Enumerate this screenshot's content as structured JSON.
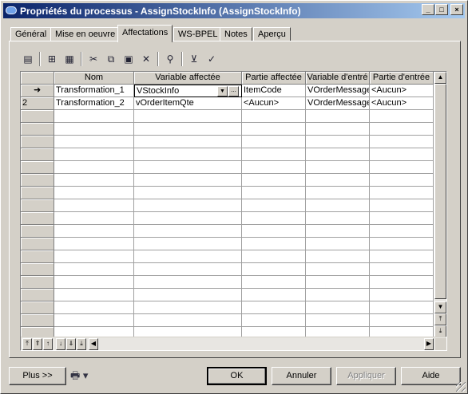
{
  "window": {
    "title": "Propriétés du processus - AssignStockInfo (AssignStockInfo)",
    "controls": {
      "minimize": "_",
      "maximize": "□",
      "close": "×"
    }
  },
  "tabs": [
    {
      "label": "Général"
    },
    {
      "label": "Mise en oeuvre"
    },
    {
      "label": "Affectations",
      "active": true
    },
    {
      "label": "WS-BPEL"
    },
    {
      "label": "Notes"
    },
    {
      "label": "Aperçu"
    }
  ],
  "toolbar": {
    "icons": [
      "properties-icon",
      "insert-row-icon",
      "add-row-icon",
      "cut-icon",
      "copy-icon",
      "paste-icon",
      "delete-icon",
      "find-icon",
      "filter-icon",
      "customize-columns-icon"
    ]
  },
  "grid": {
    "columns": [
      "Nom",
      "Variable affectée",
      "Partie affectée",
      "Variable d'entré",
      "Partie d'entrée"
    ],
    "rows": [
      {
        "marker": "➜",
        "nom": "Transformation_1",
        "variable": "VStockInfo",
        "partie": "ItemCode",
        "var_entree": "VOrderMessage",
        "partie_entree": "<Aucun>"
      },
      {
        "marker": "2",
        "nom": "Transformation_2",
        "variable": "vOrderItemQte",
        "partie": "<Aucun>",
        "var_entree": "VOrderMessage",
        "partie_entree": "<Aucun>"
      }
    ],
    "ellipsis": "..."
  },
  "buttons": {
    "more": "Plus >>",
    "ok": "OK",
    "cancel": "Annuler",
    "apply": "Appliquer",
    "help": "Aide"
  }
}
